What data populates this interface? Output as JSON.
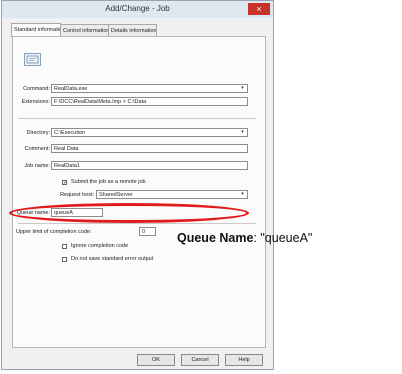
{
  "window": {
    "title": "Add/Change - Job",
    "close_label": "×"
  },
  "tabs": [
    {
      "label": "Standard information"
    },
    {
      "label": "Control information"
    },
    {
      "label": "Details information"
    }
  ],
  "form": {
    "command_label": "Command:",
    "command_value": "RealData.exe",
    "extensions_label": "Extensions:",
    "extensions_value": "F:\\DCC\\RealData\\Meta.Imp > C:\\Data",
    "directory_label": "Directory:",
    "directory_value": "C:\\Execution",
    "comment_label": "Comment:",
    "comment_value": "Real Data",
    "job_name_label": "Job name:",
    "job_name_value": "RealData1",
    "submit_label": "Submit the job as a remote job",
    "request_host_label": "Request host:",
    "request_host_value": "SharedServer",
    "queue_name_label": "Queue name:",
    "queue_name_value": "queueA",
    "exit_code_label": "Upper limit of completion code:",
    "exit_code_value": "0",
    "ignore_label": "Ignore completion code",
    "nosave_label": "Do not save standard error output"
  },
  "buttons": {
    "ok": "OK",
    "cancel": "Cancel",
    "help": "Help"
  },
  "annotation": {
    "bold": "Queue Name",
    "rest": ": \"queueA\""
  },
  "colors": {
    "highlight": "#e11b1b"
  }
}
